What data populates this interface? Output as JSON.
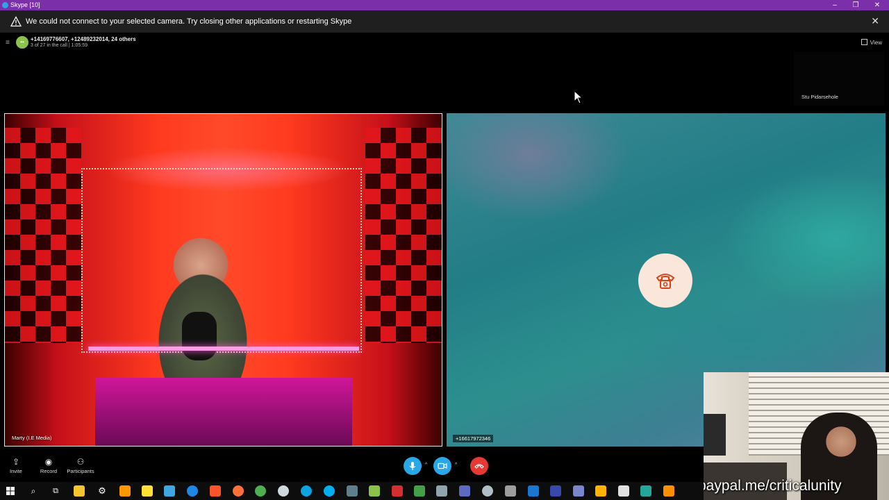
{
  "window": {
    "title": "Skype [10]",
    "controls": {
      "minimize": "–",
      "maximize": "❐",
      "close": "✕"
    }
  },
  "banner": {
    "message": "We could not connect to your selected camera. Try closing other applications or restarting Skype",
    "close": "✕"
  },
  "call": {
    "participants_title": "+14169776607, +12489232014, 24 others",
    "status": "3 of 27 in the call | 1:05:59",
    "view_label": "View",
    "menu_icon": "≡"
  },
  "tiles": {
    "small_name": "Stu Pidarsehole",
    "left_name": "Marty (I.E Media)",
    "right_name": "+16617972346"
  },
  "controls": {
    "invite": "Invite",
    "record": "Record",
    "participants": "Participants"
  },
  "watermark": "paypal.me/criticalunity",
  "colors": {
    "titlebar": "#7b2fa8",
    "mic": "#2aa7e6",
    "end_call": "#e53935",
    "banner": "#1f1f1f"
  },
  "taskbar_icons": [
    "windows-start-icon",
    "search-icon",
    "task-view-icon",
    "file-explorer-icon",
    "settings-icon",
    "sublime-icon",
    "notes-icon",
    "app-icon",
    "ie-icon",
    "brave-icon",
    "firefox-icon",
    "chrome-icon",
    "app-icon",
    "edge-icon",
    "skype-icon",
    "app-icon",
    "app-icon",
    "app-icon",
    "app-icon",
    "app-icon",
    "app-icon",
    "app-icon",
    "app-icon",
    "app-icon",
    "app-icon",
    "app-icon",
    "app-icon",
    "app-icon",
    "app-icon",
    "vlc-icon"
  ]
}
